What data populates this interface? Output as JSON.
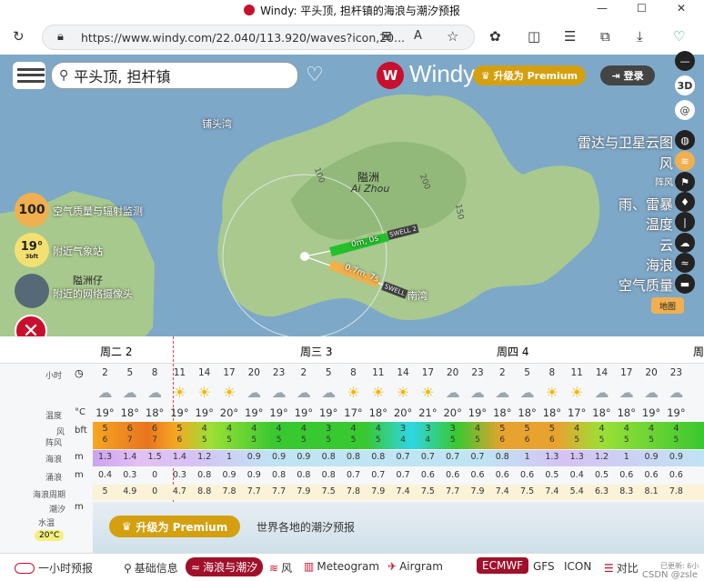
{
  "window": {
    "title": "Windy: 平头顶, 担杆镇的海浪与潮汐预报",
    "min": "—",
    "max": "☐",
    "close": "✕"
  },
  "browser": {
    "url": "https://www.windy.com/22.040/113.920/waves?icon,20..."
  },
  "search": {
    "value": "平头顶, 担杆镇"
  },
  "header": {
    "logo": "Windy",
    "premium": "升级为 Premium",
    "login": "登录"
  },
  "map": {
    "places": [
      {
        "name": "铺头湾"
      },
      {
        "name": "隘洲"
      },
      {
        "name": "Ai Zhou"
      },
      {
        "name": "南湾"
      }
    ],
    "contours": [
      "100",
      "200",
      "150"
    ],
    "swell_labels": [
      {
        "value": "0m, 0s",
        "tag": "SWELL 2"
      },
      {
        "value": "0.7m, 7s",
        "tag": "SWELL"
      }
    ],
    "widgets": [
      {
        "value": "100",
        "label": "空气质量与辐射监测"
      },
      {
        "value": "19°",
        "sub": "3bft",
        "label": "附近气象站"
      },
      {
        "label": "隘洲仔",
        "sub": "附近的网络摄像头"
      }
    ],
    "layers": [
      "雷达与卫星云图",
      "风",
      "阵风",
      "雨、雷暴",
      "温度",
      "云",
      "海浪",
      "空气质量"
    ],
    "layer_btn": "地图",
    "zoom_label": "3D"
  },
  "forecast": {
    "days": [
      {
        "label": "周二 2"
      },
      {
        "label": "周三 3"
      },
      {
        "label": "周四 4"
      },
      {
        "label": "周"
      }
    ],
    "rows": {
      "hours": {
        "label": "小时",
        "values": [
          "2",
          "5",
          "8",
          "11",
          "14",
          "17",
          "20",
          "23",
          "2",
          "5",
          "8",
          "11",
          "14",
          "17",
          "20",
          "23",
          "2",
          "5",
          "8",
          "11",
          "14",
          "17",
          "20",
          "23"
        ]
      },
      "temp": {
        "label": "温度",
        "unit": "°C",
        "values": [
          "19°",
          "18°",
          "18°",
          "19°",
          "19°",
          "20°",
          "19°",
          "19°",
          "19°",
          "19°",
          "17°",
          "18°",
          "20°",
          "21°",
          "20°",
          "19°",
          "18°",
          "18°",
          "18°",
          "17°",
          "18°",
          "18°",
          "19°",
          "19°"
        ]
      },
      "wind": {
        "label": "风",
        "unit": "bft",
        "values": [
          "5",
          "6",
          "6",
          "5",
          "4",
          "4",
          "4",
          "4",
          "4",
          "3",
          "4",
          "4",
          "3",
          "3",
          "3",
          "4",
          "5",
          "5",
          "5",
          "4",
          "4",
          "4",
          "4",
          "4"
        ]
      },
      "gust": {
        "label": "阵风",
        "values": [
          "6",
          "7",
          "7",
          "6",
          "5",
          "5",
          "5",
          "5",
          "5",
          "5",
          "5",
          "5",
          "4",
          "4",
          "5",
          "5",
          "6",
          "6",
          "6",
          "5",
          "5",
          "5",
          "5",
          "5"
        ]
      },
      "waves": {
        "label": "海浪",
        "unit": "m",
        "values": [
          "1.3",
          "1.4",
          "1.5",
          "1.4",
          "1.2",
          "1",
          "0.9",
          "0.9",
          "0.9",
          "0.8",
          "0.8",
          "0.8",
          "0.7",
          "0.7",
          "0.7",
          "0.7",
          "0.8",
          "1",
          "1.3",
          "1.3",
          "1.2",
          "1",
          "0.9",
          "0.9"
        ]
      },
      "swell": {
        "label": "涌浪",
        "unit": "m",
        "values": [
          "0.4",
          "0.3",
          "0",
          "0.3",
          "0.8",
          "0.9",
          "0.9",
          "0.8",
          "0.8",
          "0.8",
          "0.7",
          "0.7",
          "0.7",
          "0.6",
          "0.6",
          "0.6",
          "0.6",
          "0.6",
          "0.5",
          "0.4",
          "0.5",
          "0.6",
          "0.6",
          "0.6"
        ]
      },
      "period": {
        "label": "海浪周期",
        "values": [
          "5",
          "4.9",
          "0",
          "4.7",
          "8.8",
          "7.8",
          "7.7",
          "7.7",
          "7.9",
          "7.5",
          "7.8",
          "7.9",
          "7.4",
          "7.5",
          "7.7",
          "7.9",
          "7.4",
          "7.5",
          "7.4",
          "5.4",
          "6.3",
          "8.3",
          "8.1",
          "7.8"
        ]
      },
      "tide": {
        "label": "潮汐",
        "unit": "m"
      },
      "water": {
        "label": "水温",
        "value": "20°C"
      }
    },
    "promo": {
      "button": "升级为 Premium",
      "text": "世界各地的潮汐预报"
    }
  },
  "bottom": {
    "toggle": "一小时预报",
    "items": [
      "基础信息",
      "海浪与潮汐",
      "风",
      "Meteogram",
      "Airgram"
    ],
    "models": [
      "ECMWF",
      "GFS",
      "ICON",
      "对比"
    ],
    "updated": "已更新: 6小",
    "watermark": "CSDN @zsle"
  }
}
